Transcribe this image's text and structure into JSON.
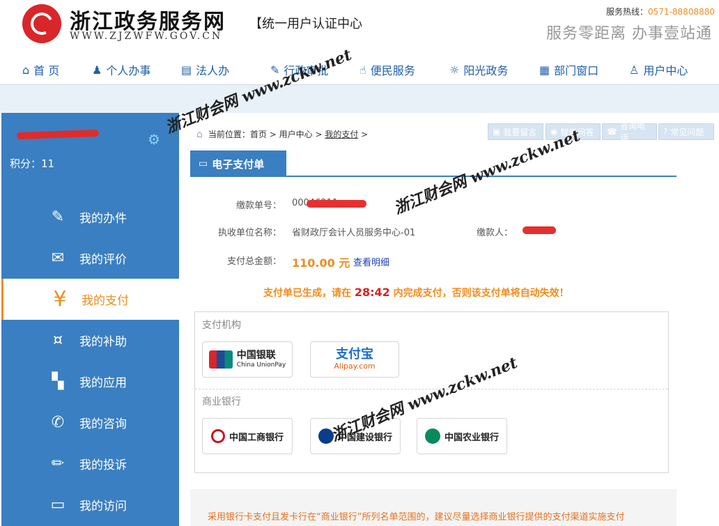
{
  "header": {
    "site_name": "浙江政务服务网",
    "site_domain": "WWW.ZJZWFW.GOV.CN",
    "sub_title": "【统一用户认证中心",
    "hotline_label": "服务热线：",
    "hotline_number": "0571-88808880",
    "slogan": "服务零距离 办事壹站通"
  },
  "nav": {
    "items": [
      {
        "label": "首 页",
        "icon": "home-icon"
      },
      {
        "label": "个人办事",
        "icon": "person-icon"
      },
      {
        "label": "法人办",
        "icon": "id-card-icon"
      },
      {
        "label": "行政审批",
        "icon": "edit-icon"
      },
      {
        "label": "便民服务",
        "icon": "hand-icon"
      },
      {
        "label": "阳光政务",
        "icon": "sun-icon"
      },
      {
        "label": "部门窗口",
        "icon": "building-icon"
      },
      {
        "label": "用户中心",
        "icon": "user-icon"
      }
    ]
  },
  "sidebar": {
    "points": "积分：11",
    "items": [
      {
        "label": "我的办件",
        "icon": "edit-icon"
      },
      {
        "label": "我的评价",
        "icon": "comment-icon"
      },
      {
        "label": "我的支付",
        "icon": "yen-icon"
      },
      {
        "label": "我的补助",
        "icon": "money-icon"
      },
      {
        "label": "我的应用",
        "icon": "apps-icon"
      },
      {
        "label": "我的咨询",
        "icon": "phone-icon"
      },
      {
        "label": "我的投诉",
        "icon": "pencil-icon"
      },
      {
        "label": "我的访问",
        "icon": "window-icon"
      }
    ],
    "active_index": 2
  },
  "breadcrumb": {
    "prefix": "当前位置：",
    "items": [
      "首页",
      "用户中心",
      "我的支付"
    ],
    "sep": " > "
  },
  "quick_links": [
    "我要留言",
    "智能问答",
    "咨询电话",
    "常见问题"
  ],
  "tab": {
    "label": "电子支付单"
  },
  "payment": {
    "order_label": "缴款单号：",
    "order_value": "00046211",
    "unit_label": "执收单位名称：",
    "unit_value": "省财政厅会计人员服务中心-01",
    "payer_label": "缴款人：",
    "amount_label": "支付总金额：",
    "amount_value": "110.00 元",
    "detail_link": "查看明细",
    "notice_before": "支付单已生成，请在 ",
    "notice_timer": "28:42",
    "notice_after": " 内完成支付，否则该支付单将自动失效！"
  },
  "institutions": {
    "pay_title": "支付机构",
    "bank_title": "商业银行",
    "pay_orgs": [
      {
        "name": "中国银联",
        "sub": "China UnionPay"
      },
      {
        "name": "支付宝",
        "sub": "Alipay.com"
      }
    ],
    "banks": [
      {
        "name": "中国工商银行"
      },
      {
        "name": "中国建设银行"
      },
      {
        "name": "中国农业银行"
      }
    ]
  },
  "footer_note": "采用银行卡支付且发卡行在“商业银行”所列名单范围的，建议尽量选择商业银行提供的支付渠道实施支付",
  "watermarks": [
    "浙江财会网 www.zckw.net",
    "浙江财会网 www.zckw.net",
    "浙江财会网 www.zckw.net"
  ]
}
